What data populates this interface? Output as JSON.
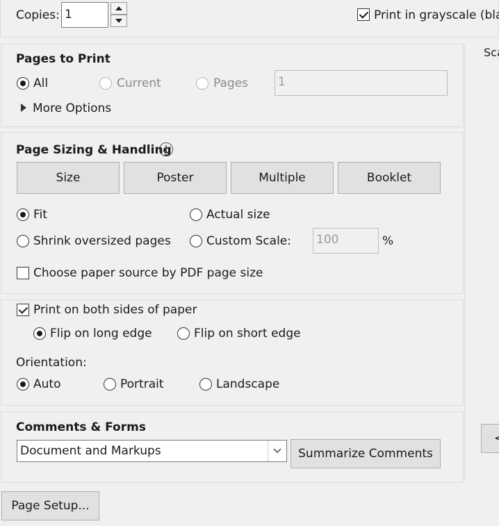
{
  "copies": {
    "label": "Copies:",
    "value": "1"
  },
  "grayscale": {
    "label": "Print in grayscale (black",
    "checked": true
  },
  "pages_to_print": {
    "title": "Pages to Print",
    "options": [
      "All",
      "Current",
      "Pages"
    ],
    "pages_value": "1",
    "more_options": "More Options"
  },
  "sizing": {
    "title": "Page Sizing & Handling",
    "buttons": [
      "Size",
      "Poster",
      "Multiple",
      "Booklet"
    ],
    "options": [
      "Fit",
      "Actual size",
      "Shrink oversized pages",
      "Custom Scale:"
    ],
    "scale_value": "100",
    "scale_unit": "%",
    "paper_source": "Choose paper source by PDF page size"
  },
  "duplex": {
    "label": "Print on both sides of paper",
    "flip_long": "Flip on long edge",
    "flip_short": "Flip on short edge"
  },
  "orientation": {
    "label": "Orientation:",
    "options": [
      "Auto",
      "Portrait",
      "Landscape"
    ]
  },
  "comments": {
    "title": "Comments & Forms",
    "selected": "Document and Markups",
    "summarize": "Summarize Comments"
  },
  "page_setup": "Page Setup...",
  "right_panel": {
    "scale_partial": "Sca",
    "nav_partial": "<"
  }
}
